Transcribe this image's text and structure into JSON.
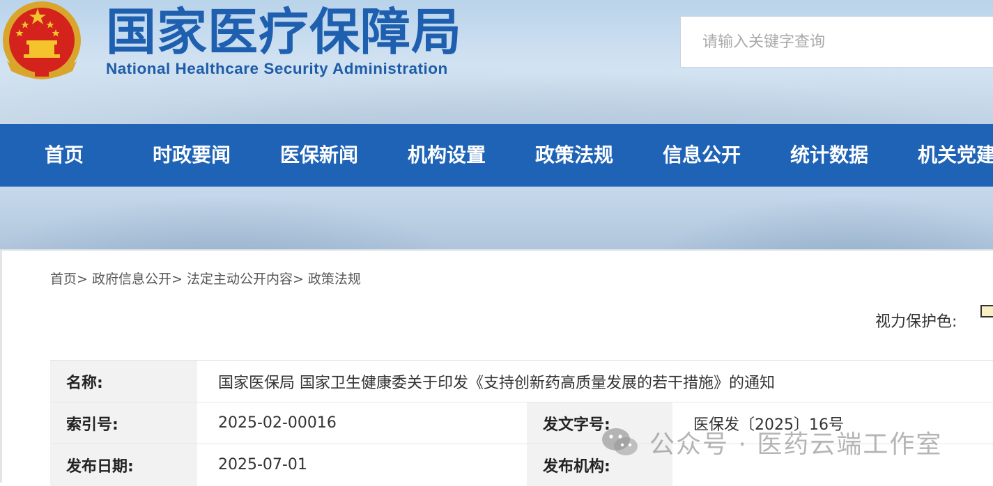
{
  "header": {
    "title_cn": "国家医疗保障局",
    "title_en": "National Healthcare Security Administration",
    "emblem_icon": "national-emblem-icon"
  },
  "search": {
    "placeholder": "请输入关键字查询"
  },
  "nav": {
    "items": [
      {
        "label": "首页"
      },
      {
        "label": "时政要闻"
      },
      {
        "label": "医保新闻"
      },
      {
        "label": "机构设置"
      },
      {
        "label": "政策法规"
      },
      {
        "label": "信息公开"
      },
      {
        "label": "统计数据"
      },
      {
        "label": "机关党建"
      }
    ]
  },
  "breadcrumb": {
    "items": [
      {
        "label": "首页>"
      },
      {
        "label": "政府信息公开>"
      },
      {
        "label": "法定主动公开内容>"
      },
      {
        "label": "政策法规"
      }
    ]
  },
  "eye_protection": {
    "label": "视力保护色:",
    "swatch_color": "#f7f0c4"
  },
  "doc_info": {
    "name_label": "名称:",
    "name_value": "国家医保局 国家卫生健康委关于印发《支持创新药高质量发展的若干措施》的通知",
    "index_label": "索引号:",
    "index_value": "2025-02-00016",
    "docno_label": "发文字号:",
    "docno_value": "医保发〔2025〕16号",
    "date_label": "发布日期:",
    "date_value": "2025-07-01",
    "org_label": "发布机构:",
    "org_value": ""
  },
  "watermark": {
    "text": "公众号 · 医药云端工作室",
    "icon": "wechat-icon"
  },
  "colors": {
    "nav_bg": "#1f63b6",
    "title_blue": "#1e5fb0",
    "label_bg": "#f2f2f2"
  }
}
